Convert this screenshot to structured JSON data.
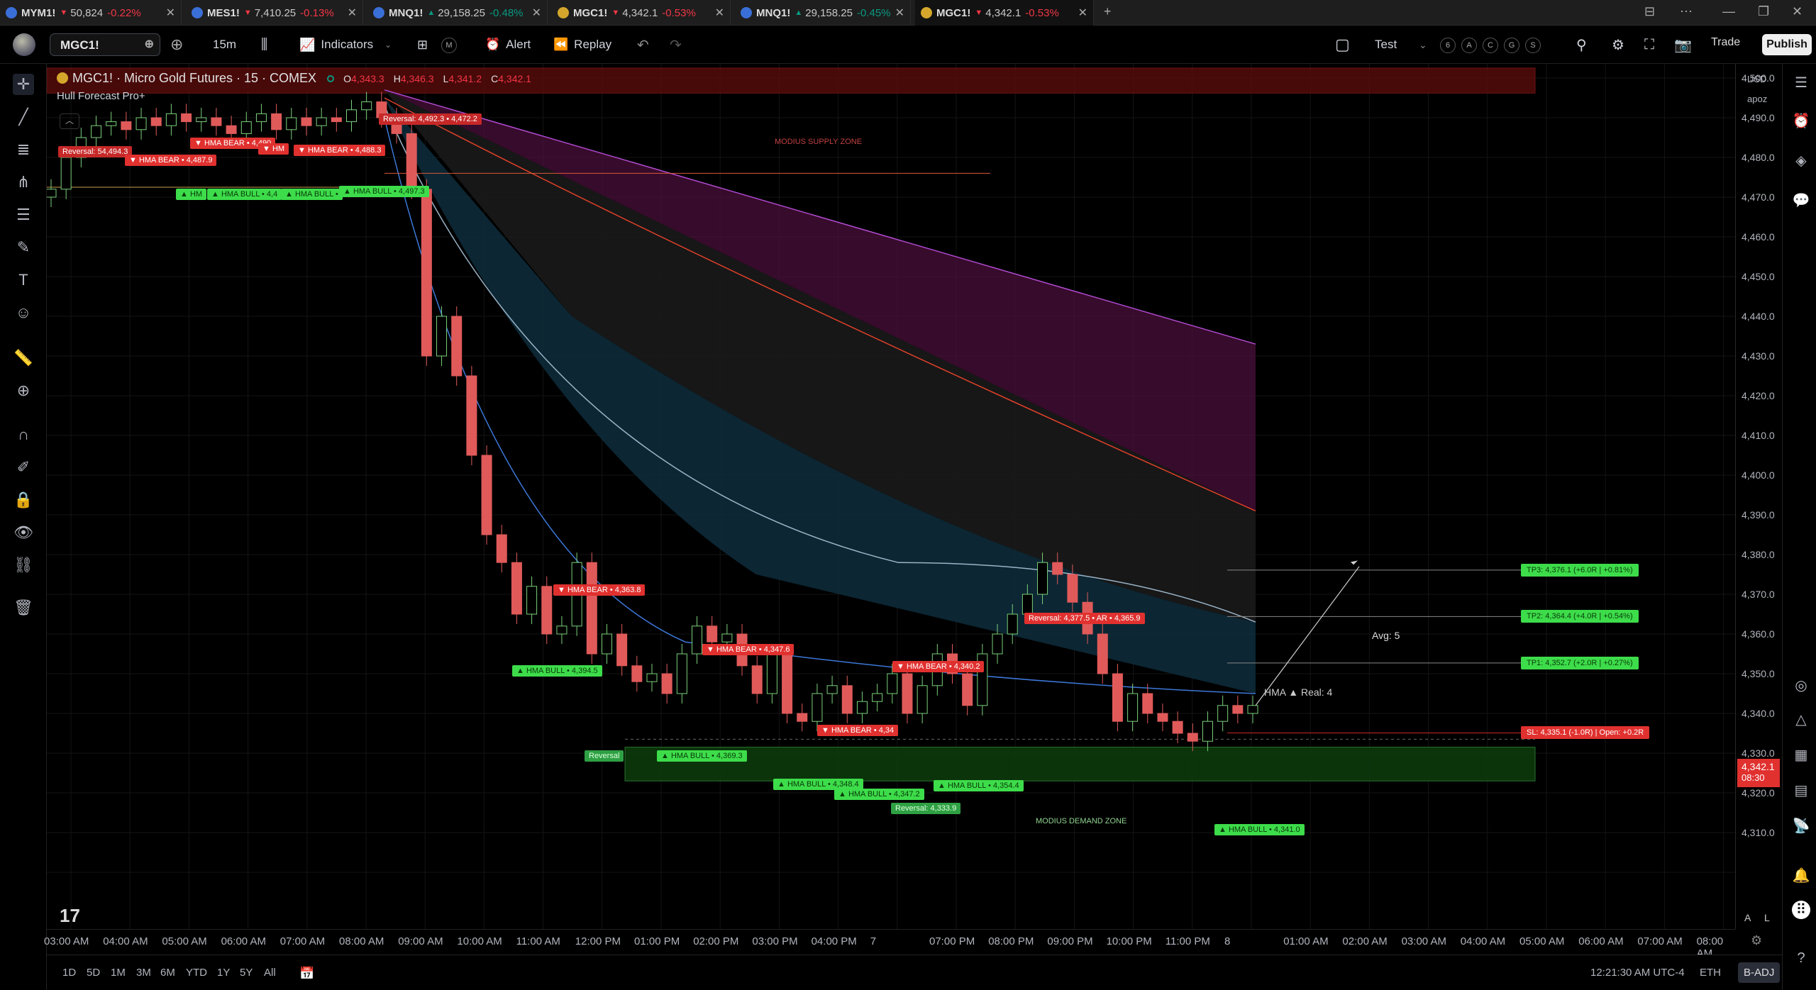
{
  "tabs": [
    {
      "symbol": "MYM1!",
      "price": "50,824",
      "change": "-0.22%",
      "dir": "neg",
      "flag": "#3a6fd8"
    },
    {
      "symbol": "MES1!",
      "price": "7,410.25",
      "change": "-0.13%",
      "dir": "neg",
      "flag": "#3a6fd8"
    },
    {
      "symbol": "MNQ1!",
      "price": "29,158.25",
      "change": "-0.48%",
      "dir": "pos",
      "flag": "#3a6fd8"
    },
    {
      "symbol": "MGC1!",
      "price": "4,342.1",
      "change": "-0.53%",
      "dir": "neg",
      "flag": "#d4a72c"
    },
    {
      "symbol": "MNQ1!",
      "price": "29,158.25",
      "change": "-0.45%",
      "dir": "pos",
      "flag": "#3a6fd8"
    },
    {
      "symbol": "MGC1!",
      "price": "4,342.1",
      "change": "-0.53%",
      "dir": "neg",
      "flag": "#d4a72c"
    }
  ],
  "toolbar": {
    "symbol": "MGC1!",
    "interval": "15m",
    "indicators": "Indicators",
    "alert": "Alert",
    "replay": "Replay",
    "layout_name": "Test",
    "circles": [
      "6",
      "A",
      "C",
      "G",
      "S"
    ],
    "trade": "Trade",
    "publish": "Publish"
  },
  "legend": {
    "title": "MGC1! · Micro Gold Futures · 15 · COMEX",
    "o": "4,343.3",
    "h": "4,346.3",
    "l": "4,341.2",
    "c": "4,342.1",
    "indicator": "Hull Forecast Pro+"
  },
  "price_axis": {
    "currency": "USD",
    "unit": "apoz",
    "labels": [
      "4,500.0",
      "4,490.0",
      "4,480.0",
      "4,470.0",
      "4,460.0",
      "4,450.0",
      "4,440.0",
      "4,430.0",
      "4,420.0",
      "4,410.0",
      "4,400.0",
      "4,390.0",
      "4,380.0",
      "4,370.0",
      "4,360.0",
      "4,350.0",
      "4,340.0",
      "4,330.0",
      "4,320.0",
      "4,310.0"
    ],
    "current_price": "4,342.1",
    "countdown": "08:30"
  },
  "time_axis": [
    "03:00 AM",
    "04:00 AM",
    "05:00 AM",
    "06:00 AM",
    "07:00 AM",
    "08:00 AM",
    "09:00 AM",
    "10:00 AM",
    "11:00 AM",
    "12:00 PM",
    "01:00 PM",
    "02:00 PM",
    "03:00 PM",
    "04:00 PM",
    "7",
    "07:00 PM",
    "08:00 PM",
    "09:00 PM",
    "10:00 PM",
    "11:00 PM",
    "8",
    "01:00 AM",
    "02:00 AM",
    "03:00 AM",
    "04:00 AM",
    "05:00 AM",
    "06:00 AM",
    "07:00 AM",
    "08:00 AM"
  ],
  "zones": {
    "supply": "MODIUS SUPPLY ZONE",
    "demand": "MODIUS DEMAND ZONE"
  },
  "tags": [
    {
      "text": "Reversal: 54,494.3",
      "kind": "rev"
    },
    {
      "text": "▼ HMA BEAR • 4,487.9",
      "kind": "bear"
    },
    {
      "text": "▼ HMA BEAR • 4,490",
      "kind": "bear"
    },
    {
      "text": "▼ HM",
      "kind": "bear"
    },
    {
      "text": "▼ HMA BEAR • 4,488.3",
      "kind": "bear"
    },
    {
      "text": "Reversal: 4,492.3 • 4,472.2",
      "kind": "rev"
    },
    {
      "text": "▲ HM",
      "kind": "bull"
    },
    {
      "text": "▲ HMA BULL • 4,4",
      "kind": "bull"
    },
    {
      "text": "▲ HMA BULL • ",
      "kind": "bull"
    },
    {
      "text": "▲ HMA BULL • 4,497.3",
      "kind": "bull"
    },
    {
      "text": "▼ HMA BEAR • 4,363.8",
      "kind": "bear"
    },
    {
      "text": "▲ HMA BULL • 4,394.5",
      "kind": "bull"
    },
    {
      "text": "▼ HMA BEAR • 4,347.6",
      "kind": "bear"
    },
    {
      "text": "Reversal",
      "kind": "revb"
    },
    {
      "text": "▲ HMA BULL • 4,369.3",
      "kind": "bull"
    },
    {
      "text": "▼ HMA BEAR • 4,34",
      "kind": "bear"
    },
    {
      "text": "▼ HMA BEAR • 4,340.2",
      "kind": "bear"
    },
    {
      "text": "▲ HMA BULL • 4,348.4",
      "kind": "bull"
    },
    {
      "text": "▲ HMA BULL • 4,347.2",
      "kind": "bull"
    },
    {
      "text": "Reversal: 4,333.9",
      "kind": "revb"
    },
    {
      "text": "▲ HMA BULL • 4,354.4",
      "kind": "bull"
    },
    {
      "text": "Reversal: 4,377.5 • AR • 4,365.9",
      "kind": "bear"
    },
    {
      "text": "▲ HMA BULL • 4,341.0",
      "kind": "bull"
    }
  ],
  "targets": {
    "avg": "Avg: 5",
    "real": "HMA ▲ Real: 4",
    "tp3": "TP3: 4,376.1 (+6.0R | +0.81%)",
    "tp2": "TP2: 4,364.4 (+4.0R | +0.54%)",
    "tp1": "TP1: 4,352.7 (+2.0R | +0.27%)",
    "sl": "SL: 4,335.1 (-1.0R) | Open: +0.2R"
  },
  "bottom": {
    "ranges": [
      "1D",
      "5D",
      "1M",
      "3M",
      "6M",
      "YTD",
      "1Y",
      "5Y",
      "All"
    ],
    "clock": "12:21:30 AM UTC-4",
    "session": "ETH",
    "adj": "B-ADJ",
    "axis_modes": [
      "A",
      "L"
    ]
  },
  "chart_data": {
    "type": "candlestick",
    "title": "MGC1! · Micro Gold Futures · 15 · COMEX",
    "ylim": [
      4305,
      4510
    ],
    "x_labels": [
      "03:00 AM",
      "04:00 AM",
      "05:00 AM",
      "06:00 AM",
      "07:00 AM",
      "08:00 AM",
      "09:00 AM",
      "10:00 AM",
      "11:00 AM",
      "12:00 PM",
      "01:00 PM",
      "02:00 PM",
      "03:00 PM",
      "04:00 PM",
      "7",
      "07:00 PM",
      "08:00 PM",
      "09:00 PM",
      "10:00 PM",
      "11:00 PM",
      "8"
    ],
    "close_series": [
      4472,
      4480,
      4485,
      4488,
      4489,
      4487,
      4490,
      4488,
      4491,
      4489,
      4490,
      4488,
      4486,
      4489,
      4491,
      4487,
      4490,
      4488,
      4490,
      4489,
      4492,
      4494,
      4490,
      4486,
      4472,
      4430,
      4440,
      4425,
      4405,
      4385,
      4378,
      4365,
      4372,
      4360,
      4362,
      4378,
      4355,
      4360,
      4352,
      4348,
      4350,
      4345,
      4355,
      4362,
      4358,
      4360,
      4352,
      4345,
      4355,
      4340,
      4338,
      4345,
      4347,
      4340,
      4343,
      4345,
      4350,
      4340,
      4347,
      4355,
      4350,
      4342,
      4355,
      4360,
      4365,
      4370,
      4378,
      4375,
      4368,
      4360,
      4350,
      4338,
      4345,
      4340,
      4338,
      4335,
      4333,
      4338,
      4342,
      4340,
      4342
    ]
  }
}
